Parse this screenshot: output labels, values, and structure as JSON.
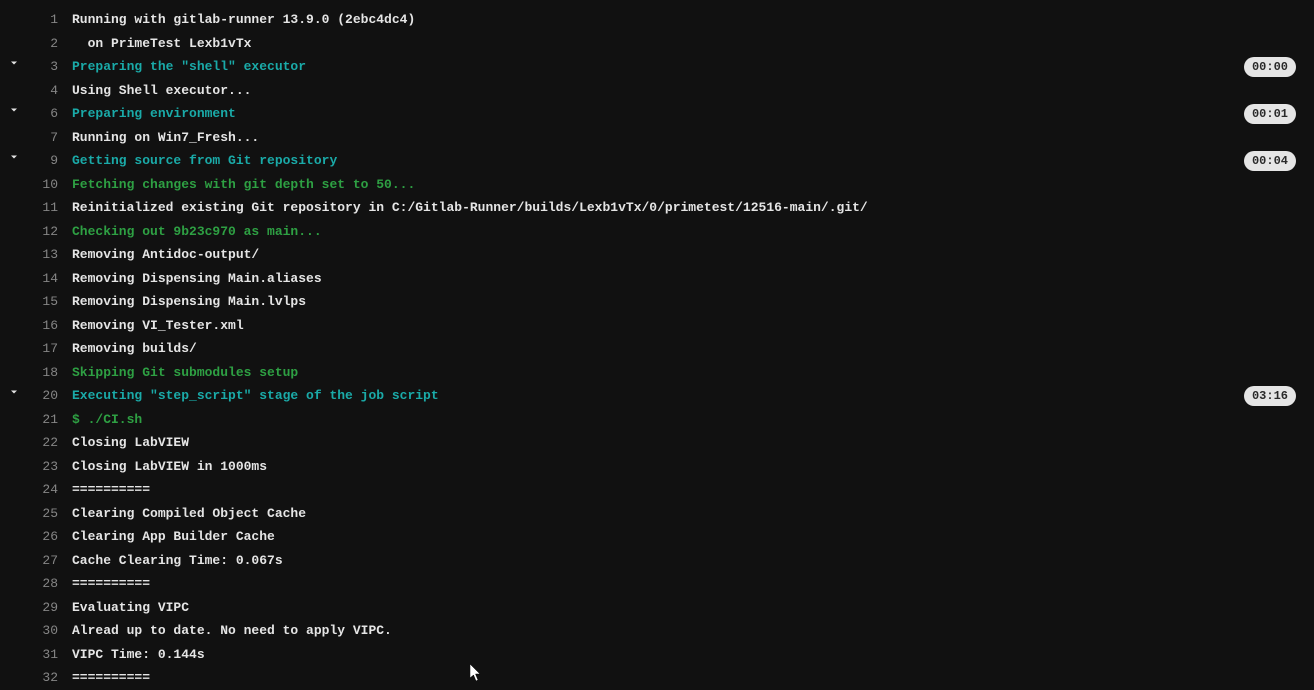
{
  "lines": [
    {
      "num": "1",
      "text": "Running with gitlab-runner 13.9.0 (2ebc4dc4)",
      "color": "white",
      "chevron": false
    },
    {
      "num": "2",
      "text": "  on PrimeTest Lexb1vTx",
      "color": "white",
      "chevron": false
    },
    {
      "num": "3",
      "text": "Preparing the \"shell\" executor",
      "color": "cyan",
      "chevron": true,
      "duration": "00:00"
    },
    {
      "num": "4",
      "text": "Using Shell executor...",
      "color": "white",
      "chevron": false
    },
    {
      "num": "6",
      "text": "Preparing environment",
      "color": "cyan",
      "chevron": true,
      "duration": "00:01"
    },
    {
      "num": "7",
      "text": "Running on Win7_Fresh...",
      "color": "white",
      "chevron": false
    },
    {
      "num": "9",
      "text": "Getting source from Git repository",
      "color": "cyan",
      "chevron": true,
      "duration": "00:04"
    },
    {
      "num": "10",
      "text": "Fetching changes with git depth set to 50...",
      "color": "green",
      "chevron": false
    },
    {
      "num": "11",
      "text": "Reinitialized existing Git repository in C:/Gitlab-Runner/builds/Lexb1vTx/0/primetest/12516-main/.git/",
      "color": "white",
      "chevron": false
    },
    {
      "num": "12",
      "text": "Checking out 9b23c970 as main...",
      "color": "green",
      "chevron": false
    },
    {
      "num": "13",
      "text": "Removing Antidoc-output/",
      "color": "white",
      "chevron": false
    },
    {
      "num": "14",
      "text": "Removing Dispensing Main.aliases",
      "color": "white",
      "chevron": false
    },
    {
      "num": "15",
      "text": "Removing Dispensing Main.lvlps",
      "color": "white",
      "chevron": false
    },
    {
      "num": "16",
      "text": "Removing VI_Tester.xml",
      "color": "white",
      "chevron": false
    },
    {
      "num": "17",
      "text": "Removing builds/",
      "color": "white",
      "chevron": false
    },
    {
      "num": "18",
      "text": "Skipping Git submodules setup",
      "color": "green",
      "chevron": false
    },
    {
      "num": "20",
      "text": "Executing \"step_script\" stage of the job script",
      "color": "cyan",
      "chevron": true,
      "duration": "03:16"
    },
    {
      "num": "21",
      "text": "$ ./CI.sh",
      "color": "green",
      "chevron": false
    },
    {
      "num": "22",
      "text": "Closing LabVIEW",
      "color": "white",
      "chevron": false
    },
    {
      "num": "23",
      "text": "Closing LabVIEW in 1000ms",
      "color": "white",
      "chevron": false
    },
    {
      "num": "24",
      "text": "==========",
      "color": "white",
      "chevron": false
    },
    {
      "num": "25",
      "text": "Clearing Compiled Object Cache",
      "color": "white",
      "chevron": false
    },
    {
      "num": "26",
      "text": "Clearing App Builder Cache",
      "color": "white",
      "chevron": false
    },
    {
      "num": "27",
      "text": "Cache Clearing Time: 0.067s",
      "color": "white",
      "chevron": false
    },
    {
      "num": "28",
      "text": "==========",
      "color": "white",
      "chevron": false
    },
    {
      "num": "29",
      "text": "Evaluating VIPC",
      "color": "white",
      "chevron": false
    },
    {
      "num": "30",
      "text": "Alread up to date. No need to apply VIPC.",
      "color": "white",
      "chevron": false
    },
    {
      "num": "31",
      "text": "VIPC Time: 0.144s",
      "color": "white",
      "chevron": false
    },
    {
      "num": "32",
      "text": "==========",
      "color": "white",
      "chevron": false
    }
  ]
}
